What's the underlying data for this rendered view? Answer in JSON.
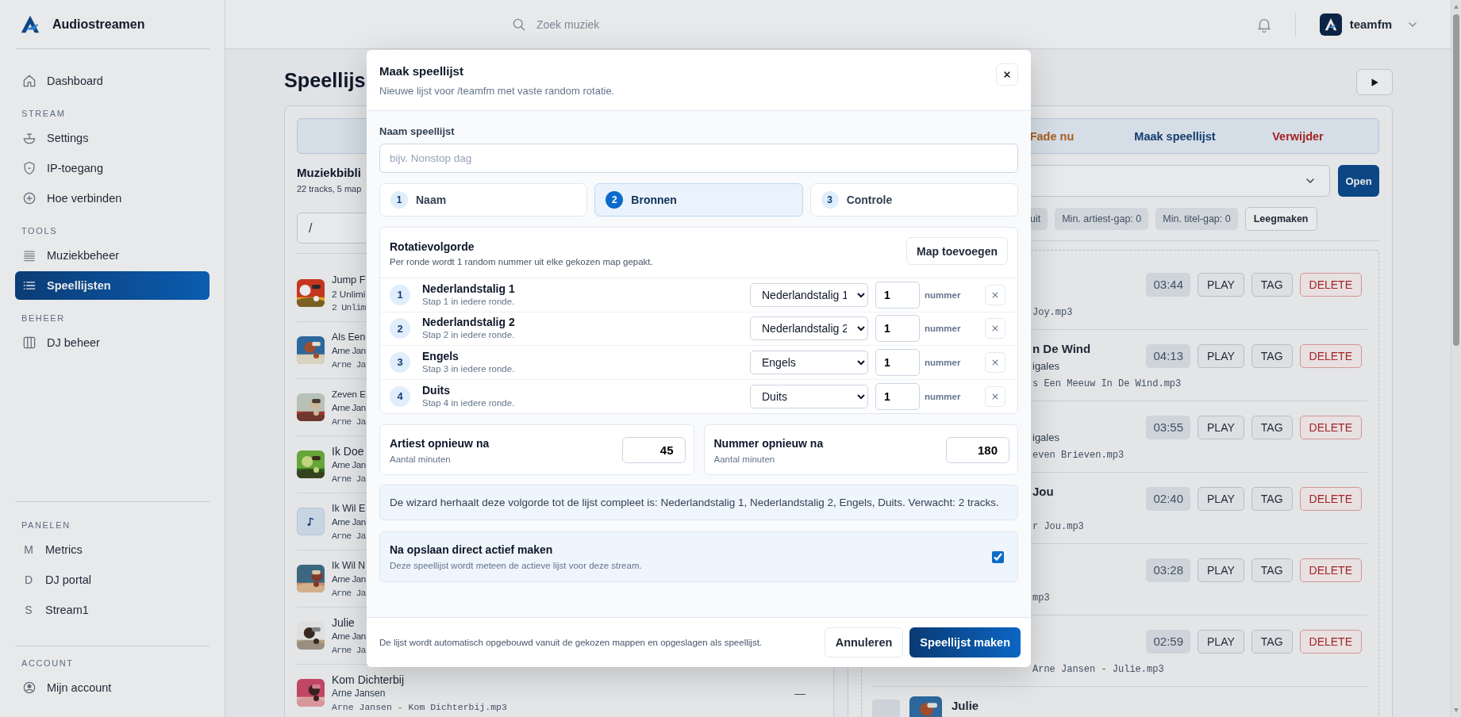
{
  "sidebar": {
    "brand": "Audiostreamen",
    "groups": [
      {
        "items": [
          {
            "label": "Dashboard",
            "selected": false
          }
        ]
      },
      {
        "heading": "STREAM",
        "items": [
          {
            "label": "Settings",
            "selected": false
          },
          {
            "label": "IP-toegang",
            "selected": false
          },
          {
            "label": "Hoe verbinden",
            "selected": false
          }
        ]
      },
      {
        "heading": "TOOLS",
        "items": [
          {
            "label": "Muziekbeheer",
            "selected": false
          },
          {
            "label": "Speellijsten",
            "selected": true
          }
        ]
      },
      {
        "heading": "BEHEER",
        "items": [
          {
            "label": "DJ beheer",
            "selected": false
          }
        ]
      }
    ],
    "footer_groups": [
      {
        "heading": "PANELEN",
        "items": [
          {
            "letter": "M",
            "label": "Metrics",
            "selected": false
          },
          {
            "letter": "D",
            "label": "DJ portal",
            "selected": false
          },
          {
            "letter": "S",
            "label": "Stream1",
            "selected": false
          }
        ]
      },
      {
        "heading": "ACCOUNT",
        "items": [
          {
            "label": "Mijn account",
            "selected": false
          }
        ]
      }
    ]
  },
  "header": {
    "search_placeholder": "Zoek muziek",
    "user": "teamfm"
  },
  "page": {
    "title": "Speellijs"
  },
  "library": {
    "title": "Muziekbibli",
    "subtitle": "22 tracks, 5 map",
    "path": "/",
    "tracks": [
      {
        "title": "Jump F",
        "artist": "2 Unlimi",
        "file": "2 Unlim",
        "kind": "picture"
      },
      {
        "title": "Als Een",
        "artist": "Arne Jan",
        "file": "Arne Ja",
        "kind": "picture"
      },
      {
        "title": "Zeven E",
        "artist": "Arne Jan",
        "file": "Arne Ja",
        "kind": "picture"
      },
      {
        "title": "Ik Doe",
        "artist": "Arne Jan",
        "file": "Arne Ja",
        "kind": "picture"
      },
      {
        "title": "Ik Wil E",
        "artist": "Arne Jan",
        "file": "Arne Ja",
        "kind": "placeholder"
      },
      {
        "title": "Ik Wil N",
        "artist": "Arne Jan",
        "file": "Arne Ja",
        "kind": "picture"
      },
      {
        "title": "Julie",
        "artist": "Arne Jan",
        "file": "Arne Ja",
        "kind": "picture"
      },
      {
        "title": "Kom Dichterbij",
        "artist": "Arne Jansen",
        "file": "Arne Jansen - Kom Dichterbij.mp3",
        "kind": "picture",
        "trailing": "—"
      }
    ]
  },
  "queue": {
    "actions": [
      {
        "label": "Fade nu",
        "kind": "warning"
      },
      {
        "label": "Maak speellijst",
        "kind": "primary"
      },
      {
        "label": "Verwijder",
        "kind": "danger"
      }
    ],
    "open_button": "Open",
    "chips": [
      "uit",
      "Min. artiest-gap: 0",
      "Min. titel-gap: 0"
    ],
    "clear_button": "Leegmaken",
    "tracks": [
      {
        "file": "Joy.mp3",
        "duration": "03:44",
        "actions": [
          "PLAY",
          "TAG",
          "DELETE"
        ]
      },
      {
        "title": "n De Wind",
        "artist": "igales",
        "file": "s Een Meeuw In De Wind.mp3",
        "duration": "04:13",
        "actions": [
          "PLAY",
          "TAG",
          "DELETE"
        ]
      },
      {
        "artist": "igales",
        "file": "even Brieven.mp3",
        "duration": "03:55",
        "actions": [
          "PLAY",
          "TAG",
          "DELETE"
        ]
      },
      {
        "title": "Jou",
        "file": "r Jou.mp3",
        "duration": "02:40",
        "actions": [
          "PLAY",
          "TAG",
          "DELETE"
        ]
      },
      {
        "file": "mp3",
        "duration": "03:28",
        "actions": [
          "PLAY",
          "TAG",
          "DELETE"
        ]
      },
      {
        "file": "Arne Jansen - Julie.mp3",
        "duration": "02:59",
        "actions": [
          "PLAY",
          "TAG",
          "DELETE"
        ]
      },
      {
        "title": "Julie",
        "kind": "picture"
      }
    ]
  },
  "modal": {
    "title": "Maak speellijst",
    "subtitle": "Nieuwe lijst voor /teamfm met vaste random rotatie.",
    "name_label": "Naam speellijst",
    "name_placeholder": "bijv. Nonstop dag",
    "steps": [
      {
        "number": "1",
        "label": "Naam",
        "selected": false
      },
      {
        "number": "2",
        "label": "Bronnen",
        "selected": true
      },
      {
        "number": "3",
        "label": "Controle",
        "selected": false
      }
    ],
    "rotation": {
      "title": "Rotatievolgorde",
      "subtitle": "Per ronde wordt 1 random nummer uit elke gekozen map gepakt.",
      "add_button": "Map toevoegen",
      "rows": [
        {
          "number": "1",
          "name": "Nederlandstalig 1",
          "hint": "Stap 1 in iedere ronde.",
          "folder": "Nederlandstalig 1",
          "count": "1",
          "unit": "nummer"
        },
        {
          "number": "2",
          "name": "Nederlandstalig 2",
          "hint": "Stap 2 in iedere ronde.",
          "folder": "Nederlandstalig 2",
          "count": "1",
          "unit": "nummer"
        },
        {
          "number": "3",
          "name": "Engels",
          "hint": "Stap 3 in iedere ronde.",
          "folder": "Engels",
          "count": "1",
          "unit": "nummer"
        },
        {
          "number": "4",
          "name": "Duits",
          "hint": "Stap 4 in iedere ronde.",
          "folder": "Duits",
          "count": "1",
          "unit": "nummer"
        }
      ]
    },
    "gaps": [
      {
        "label": "Artiest opnieuw na",
        "hint": "Aantal minuten",
        "value": "45"
      },
      {
        "label": "Nummer opnieuw na",
        "hint": "Aantal minuten",
        "value": "180"
      }
    ],
    "summary": "De wizard herhaalt deze volgorde tot de lijst compleet is: Nederlandstalig 1, Nederlandstalig 2, Engels, Duits. Verwacht: 2 tracks.",
    "activate": {
      "label": "Na opslaan direct actief maken",
      "hint": "Deze speellijst wordt meteen de actieve lijst voor deze stream.",
      "checked": true
    },
    "footer_note": "De lijst wordt automatisch opgebouwd vanuit de gekozen mappen en opgeslagen als speellijst.",
    "cancel": "Annuleren",
    "submit": "Speellijst maken"
  }
}
